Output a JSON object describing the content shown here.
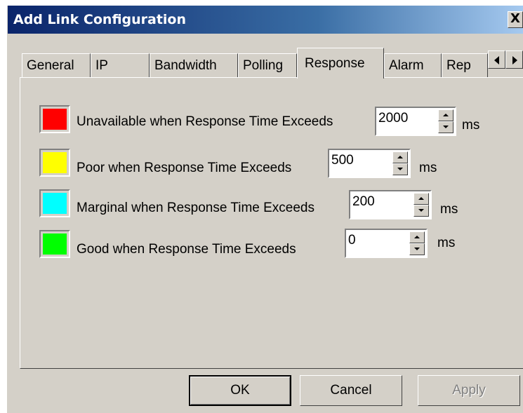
{
  "window": {
    "title": "Add Link Configuration",
    "close_label": "X"
  },
  "tabs": [
    {
      "label": "General",
      "active": false
    },
    {
      "label": "IP",
      "active": false
    },
    {
      "label": "Bandwidth",
      "active": false
    },
    {
      "label": "Polling",
      "active": false
    },
    {
      "label": "Response",
      "active": true
    },
    {
      "label": "Alarm",
      "active": false
    },
    {
      "label": "Rep",
      "active": false
    }
  ],
  "thresholds": [
    {
      "color": "#ff0000",
      "label": "Unavailable when Response Time Exceeds",
      "value": "2000",
      "unit": "ms"
    },
    {
      "color": "#ffff00",
      "label": "Poor  when Response Time Exceeds",
      "value": "500",
      "unit": "ms"
    },
    {
      "color": "#00ffff",
      "label": "Marginal when Response Time Exceeds",
      "value": "200",
      "unit": "ms"
    },
    {
      "color": "#00ff00",
      "label": "Good when Response Time Exceeds",
      "value": "0",
      "unit": "ms"
    }
  ],
  "buttons": {
    "ok": "OK",
    "cancel": "Cancel",
    "apply": "Apply"
  }
}
